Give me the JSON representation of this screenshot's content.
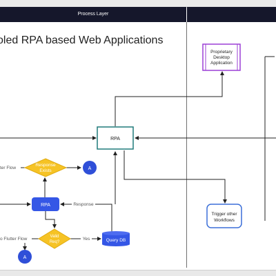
{
  "lanes": {
    "process_layer": "Process Layer",
    "right_lane": ""
  },
  "title": "oled RPA based Web Applications",
  "nodes": {
    "rpa_main": "RPA",
    "rpa_small": "RPA",
    "proprietary_app": [
      "Proprietary",
      "Desktop",
      "Application"
    ],
    "trigger_workflows": [
      "Trigger other",
      "Workflows"
    ],
    "response_exists": [
      "Response",
      "Exists"
    ],
    "valid_req": [
      "Valid",
      "Req?"
    ],
    "query_db": "Query DB",
    "connector_top": "A",
    "connector_bottom": "A"
  },
  "edge_labels": {
    "flow_top": "ter Flow",
    "flutter_flow": "o Flutter Flow",
    "response": "Response",
    "yes": "Yes"
  },
  "colors": {
    "header_bg": "#15172b",
    "rpa_border": "#1f7a7a",
    "proprietary_border": "#9b3fd6",
    "trigger_border": "#3b6fd8",
    "diamond_fill": "#f6c325",
    "blue_fill": "#3557e6",
    "connector_fill": "#2f4fd8",
    "edge": "#222222"
  }
}
